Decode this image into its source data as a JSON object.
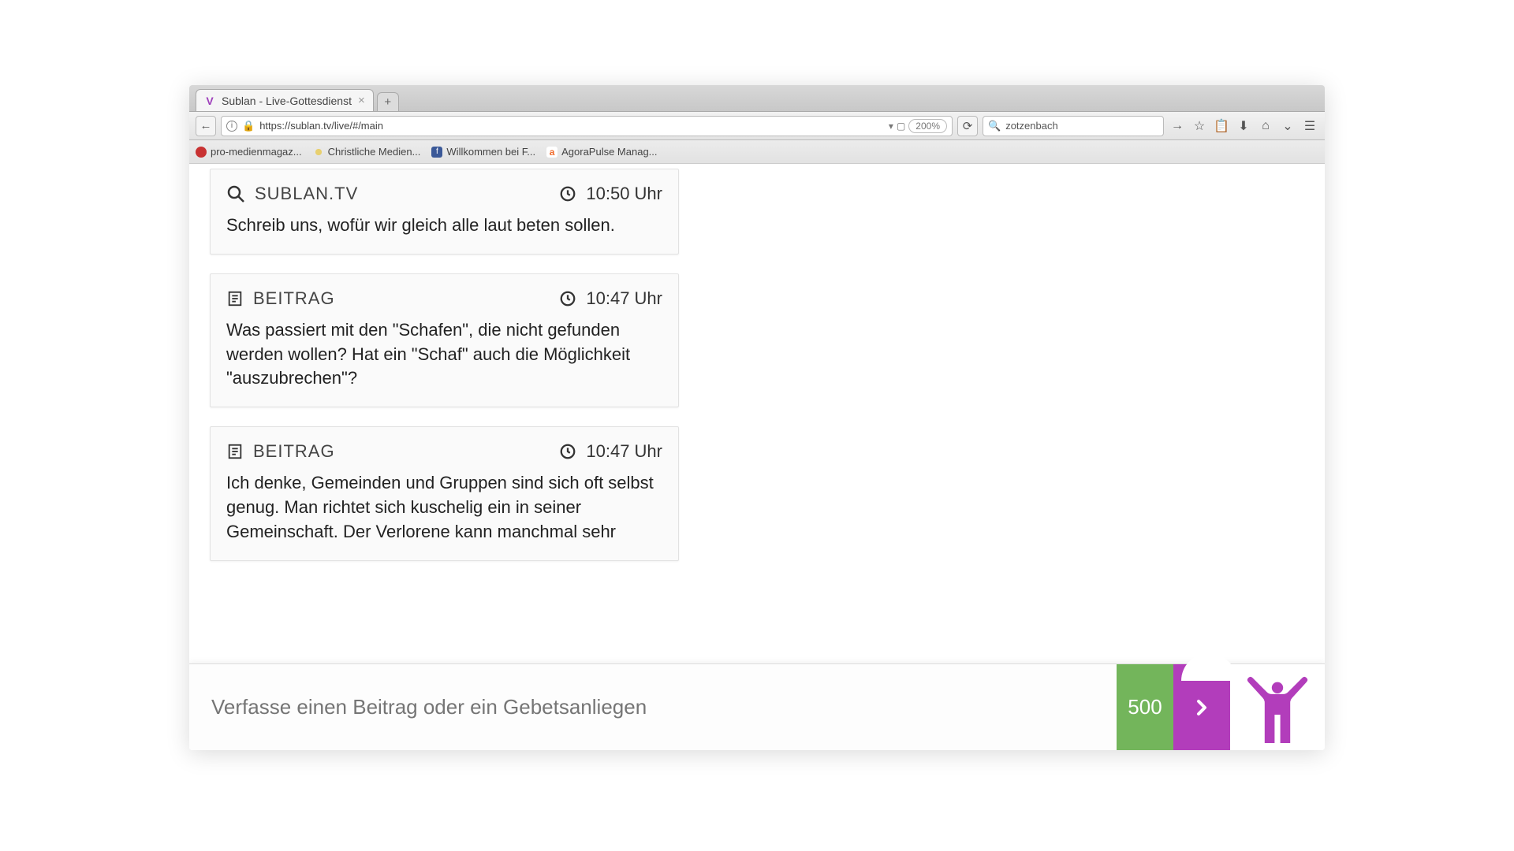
{
  "tab": {
    "title": "Sublan - Live-Gottesdienst"
  },
  "url": "https://sublan.tv/live/#/main",
  "zoom": "200%",
  "search": {
    "value": "zotzenbach"
  },
  "bookmarks": [
    {
      "label": "pro-medienmagaz...",
      "color": "#c83232"
    },
    {
      "label": "Christliche Medien...",
      "color": "#e8d070"
    },
    {
      "label": "Willkommen bei F...",
      "color": "#3b5998"
    },
    {
      "label": "AgoraPulse Manag...",
      "color": "#f06a2a"
    }
  ],
  "cards": [
    {
      "type": "search",
      "label": "SUBLAN.TV",
      "time": "10:50 Uhr",
      "body": "Schreib uns, wofür wir gleich alle laut beten sollen."
    },
    {
      "type": "post",
      "label": "BEITRAG",
      "time": "10:47 Uhr",
      "body": "Was passiert mit den \"Schafen\", die nicht gefunden werden wollen? Hat ein \"Schaf\" auch die Möglichkeit \"auszubrechen\"?"
    },
    {
      "type": "post",
      "label": "BEITRAG",
      "time": "10:47 Uhr",
      "body": "Ich denke, Gemeinden und Gruppen sind sich oft selbst genug. Man richtet sich kuschelig ein in seiner Gemeinschaft. Der Verlorene kann manchmal sehr"
    }
  ],
  "composer": {
    "placeholder": "Verfasse einen Beitrag oder ein Gebetsanliegen",
    "counter": "500"
  },
  "colors": {
    "green": "#73b55b",
    "purple": "#b23dbb"
  }
}
